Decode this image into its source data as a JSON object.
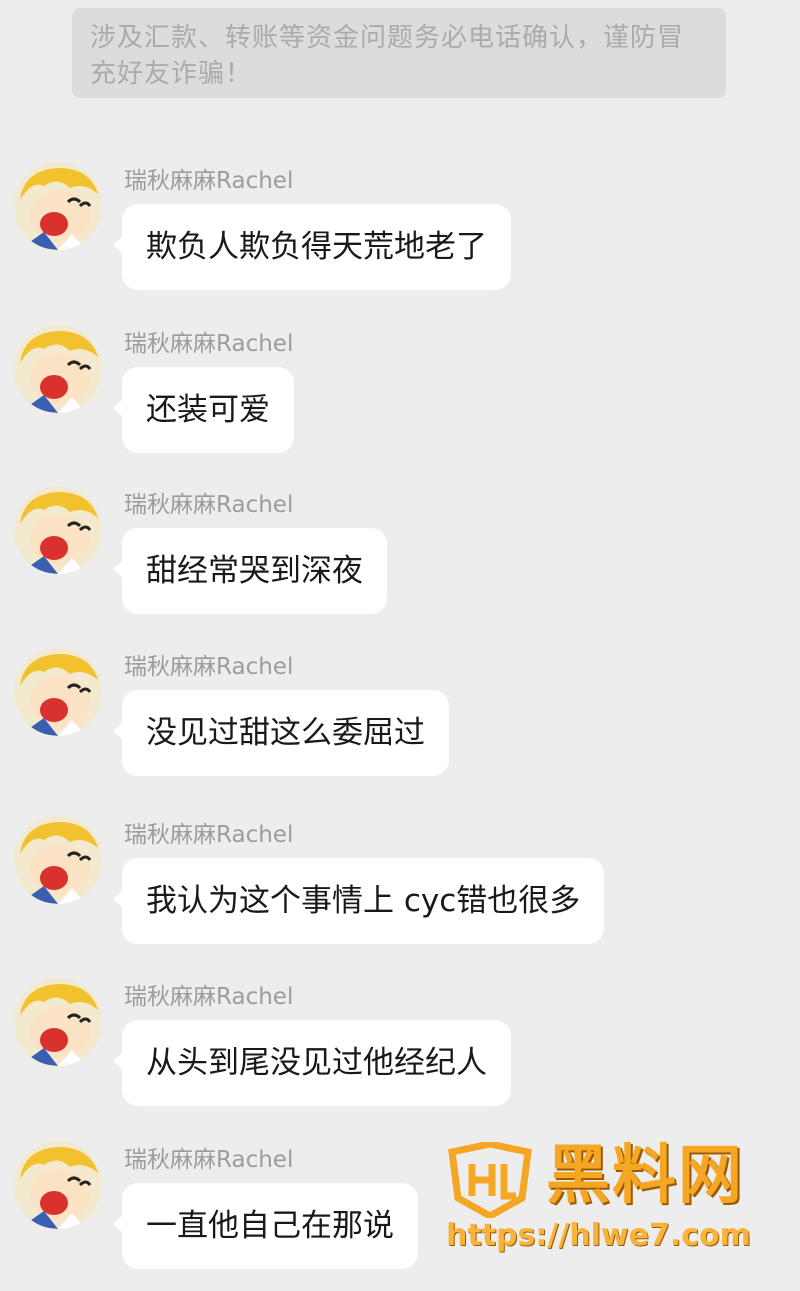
{
  "notice": {
    "text": "涉及汇款、转账等资金问题务必电话确认，谨防冒充好友诈骗！"
  },
  "messages": [
    {
      "sender": "瑞秋麻麻Rachel",
      "text": "欺负人欺负得天荒地老了"
    },
    {
      "sender": "瑞秋麻麻Rachel",
      "text": "还装可爱"
    },
    {
      "sender": "瑞秋麻麻Rachel",
      "text": "甜经常哭到深夜"
    },
    {
      "sender": "瑞秋麻麻Rachel",
      "text": "没见过甜这么委屈过"
    },
    {
      "sender": "瑞秋麻麻Rachel",
      "text": "我认为这个事情上 cyc错也很多"
    },
    {
      "sender": "瑞秋麻麻Rachel",
      "text": "从头到尾没见过他经纪人"
    },
    {
      "sender": "瑞秋麻麻Rachel",
      "text": "一直他自己在那说"
    }
  ],
  "watermark": {
    "title": "黑料网",
    "url": "https://hlwe7.com",
    "color": "#f5a623"
  },
  "colors": {
    "background": "#ededed",
    "bubble": "#ffffff",
    "notice_bg": "#dcdcdc"
  }
}
